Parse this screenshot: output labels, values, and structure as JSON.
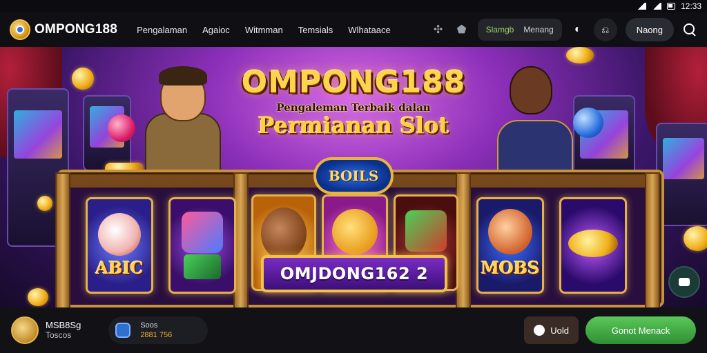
{
  "status": {
    "time": "12:33"
  },
  "nav": {
    "brand": "OMPONG188",
    "menu": [
      "Pengalaman",
      "Agaioc",
      "Witmman",
      "Temsials",
      "Wlhataace"
    ],
    "pill_a": "Slamgb",
    "pill_b": "Menang",
    "login": "Naong",
    "icons": [
      "puzzle-icon",
      "shield-icon",
      "circle-icon",
      "gift-icon",
      "search-icon"
    ]
  },
  "hero": {
    "title": "OMPONG188",
    "subtitle_small": "Pengaleman Terbaik dalan",
    "subtitle_big": "Permianan Slot",
    "badge": "BOILS",
    "plate": "OMJDONG162 2",
    "tiles": [
      {
        "label": "ABIC"
      },
      {
        "label": ""
      },
      {
        "label": ""
      },
      {
        "label": ""
      },
      {
        "label": ""
      },
      {
        "label": "MOBS"
      },
      {
        "label": ""
      }
    ]
  },
  "bottom": {
    "user_name": "MSB8Sg",
    "user_status": "Toscos",
    "wallet_label": "Soos",
    "wallet_value": "2881 756",
    "deposit_label": "Uold",
    "play_label": "Gonot Menack"
  },
  "colors": {
    "accent_green": "#3aa63f",
    "gold": "#ffd34a",
    "purple": "#8b2fb8"
  }
}
